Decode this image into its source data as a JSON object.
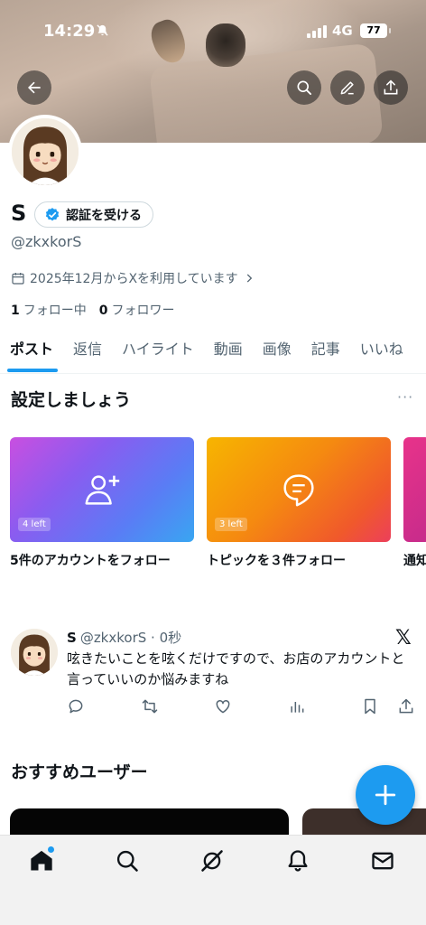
{
  "status_bar": {
    "time": "14:29",
    "network": "4G",
    "battery": "77"
  },
  "profile": {
    "display_name": "S",
    "verify_label": "認証を受ける",
    "handle": "@zkxkorS",
    "joined": "2025年12月からXを利用しています",
    "following_count": "1",
    "following_label": "フォロー中",
    "followers_count": "0",
    "followers_label": "フォロワー"
  },
  "tabs": [
    "ポスト",
    "返信",
    "ハイライト",
    "動画",
    "画像",
    "記事",
    "いいね"
  ],
  "active_tab": "ポスト",
  "setup": {
    "title": "設定しましょう",
    "more": "···",
    "cards": [
      {
        "badge": "4 left",
        "label": "5件のアカウントをフォロー",
        "icon": "add-user-icon"
      },
      {
        "badge": "3 left",
        "label": "トピックを３件フォロー",
        "icon": "topic-icon"
      },
      {
        "label": "通知"
      }
    ]
  },
  "tweet": {
    "name": "S",
    "handle_time": "@zkxkorS · 0秒",
    "text": "呟きたいことを呟くだけですので、お店のアカウントと言っていいのか悩みますね",
    "x_mark": "𝕏"
  },
  "recommend": {
    "title": "おすすめユーザー"
  },
  "colors": {
    "accent": "#1d9bf0",
    "text": "#0f1419",
    "secondary": "#536471"
  },
  "icons": [
    "back-arrow-icon",
    "search-icon",
    "edit-icon",
    "share-icon",
    "reply-icon",
    "retweet-icon",
    "like-icon",
    "views-icon",
    "bookmark-icon",
    "home-icon",
    "grok-icon",
    "bell-icon",
    "mail-icon",
    "plus-icon"
  ]
}
